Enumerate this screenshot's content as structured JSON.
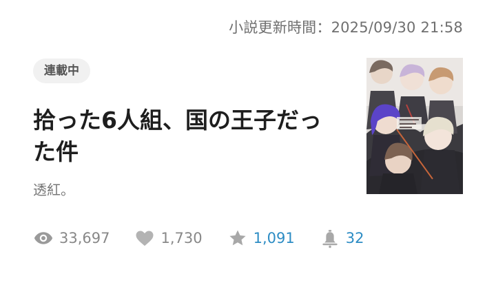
{
  "header": {
    "update_label": "小説更新時間：",
    "update_datetime": "2025/09/30 21:58"
  },
  "status_badge": "連載中",
  "novel": {
    "title": "拾った6人組、国の王子だった件",
    "author": "透紅。"
  },
  "stats": {
    "views": "33,697",
    "likes": "1,730",
    "stars": "1,091",
    "notifications": "32"
  },
  "colors": {
    "accent_blue": "#2c8cc4",
    "muted_gray": "#888888",
    "badge_bg": "#f1f1f1"
  },
  "icons": {
    "views": "eye-icon",
    "likes": "heart-icon",
    "stars": "star-icon",
    "notifications": "bell-icon"
  }
}
